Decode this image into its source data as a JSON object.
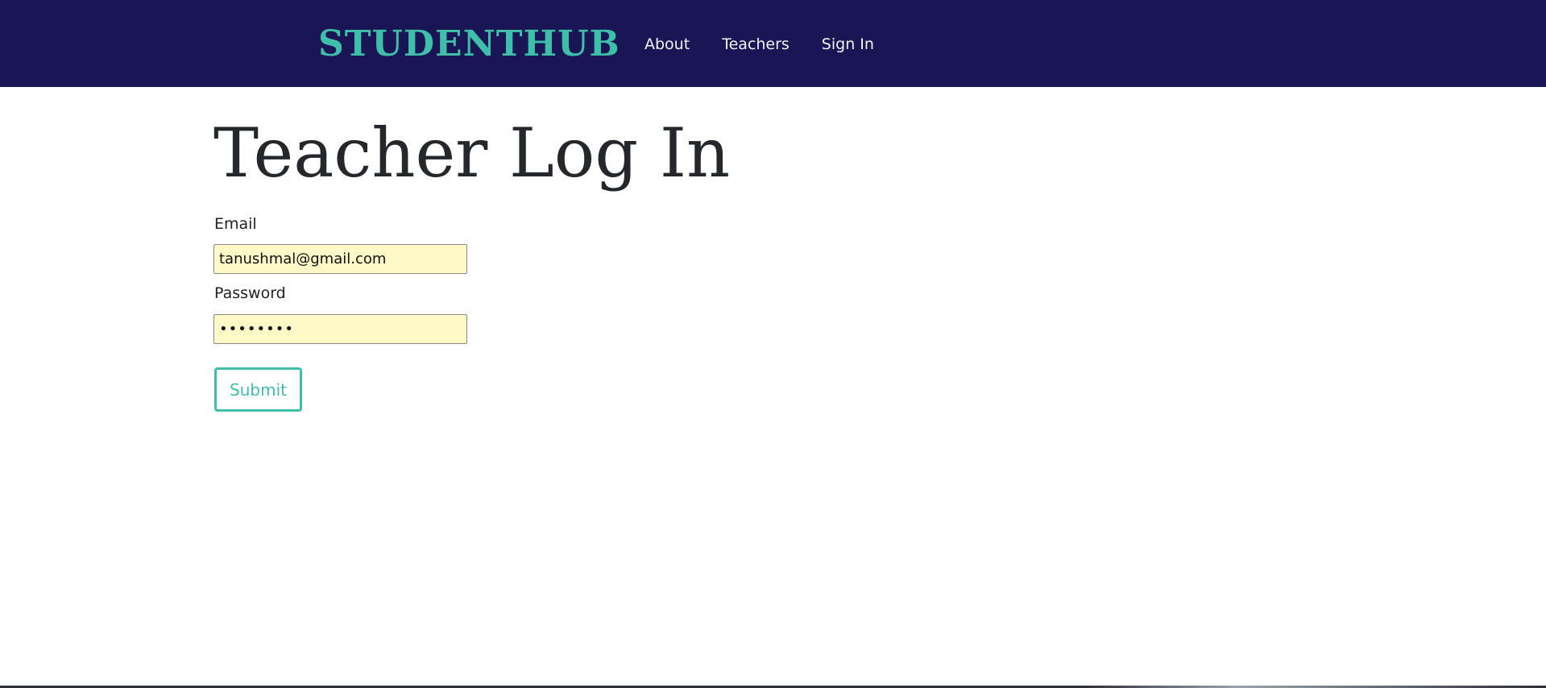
{
  "navbar": {
    "brand": "STUDENTHUB",
    "links": [
      {
        "label": "About"
      },
      {
        "label": "Teachers"
      },
      {
        "label": "Sign In"
      }
    ],
    "bg_color": "#1a1655",
    "brand_color": "#3fbfaa"
  },
  "page": {
    "title": "Teacher Log In"
  },
  "form": {
    "email_label": "Email",
    "email_value": "tanushmal@gmail.com",
    "password_label": "Password",
    "password_value": "••••••••",
    "submit_label": "Submit",
    "input_bg_color": "#fff9c8",
    "accent_color": "#3fbfaa"
  }
}
